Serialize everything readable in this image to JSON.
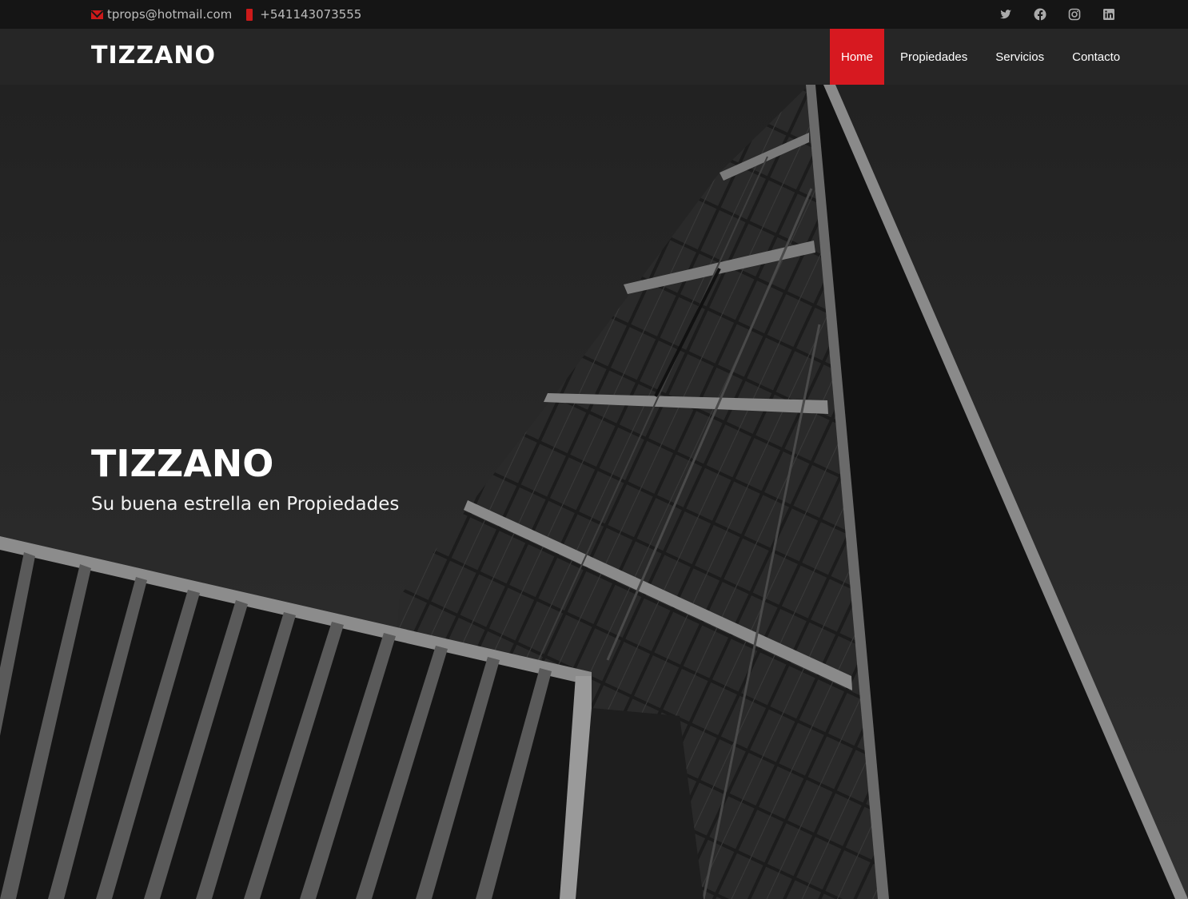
{
  "topbar": {
    "email": "tprops@hotmail.com",
    "phone": "+541143073555",
    "icons": {
      "email": "envelope-icon",
      "phone": "phone-icon",
      "social": [
        "twitter-icon",
        "facebook-icon",
        "instagram-icon",
        "linkedin-icon"
      ]
    }
  },
  "header": {
    "logo": "TIZZANO",
    "nav": [
      {
        "label": "Home",
        "active": true
      },
      {
        "label": "Propiedades",
        "active": false
      },
      {
        "label": "Servicios",
        "active": false
      },
      {
        "label": "Contacto",
        "active": false
      }
    ]
  },
  "hero": {
    "title": "TIZZANO",
    "subtitle": "Su buena estrella en Propiedades"
  },
  "colors": {
    "accent": "#d71920",
    "topbar_bg": "#151515",
    "header_bg": "#262626"
  }
}
